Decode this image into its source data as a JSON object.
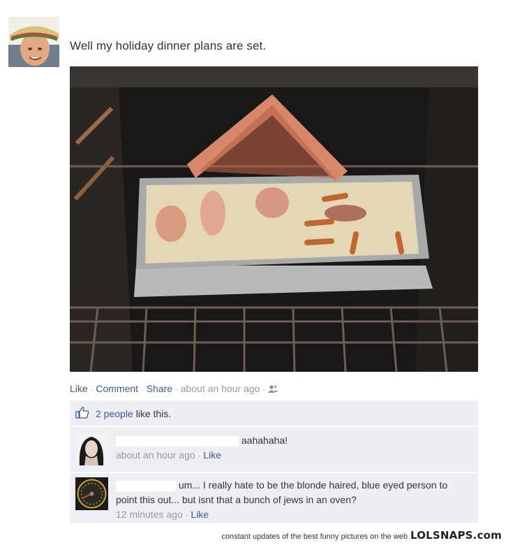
{
  "post": {
    "status": "Well my holiday dinner plans are set."
  },
  "actions": {
    "like": "Like",
    "comment": "Comment",
    "share": "Share",
    "time": "about an hour ago"
  },
  "likes": {
    "count_link": "2 people",
    "suffix": "like this."
  },
  "comments": [
    {
      "text": "aahahaha!",
      "time": "about an hour ago",
      "like": "Like"
    },
    {
      "text": "um... I really hate to be the blonde haired, blue eyed person to point this out... but isnt that a bunch of jews in an oven?",
      "time": "12 minutes ago",
      "like": "Like"
    }
  ],
  "footer": {
    "tagline": "constant updates of the best funny pictures on the web",
    "brand": "LOLSNAPS.com"
  },
  "colors": {
    "link": "#3b5998",
    "comment_bg": "#edeff4",
    "meta": "#999999"
  }
}
